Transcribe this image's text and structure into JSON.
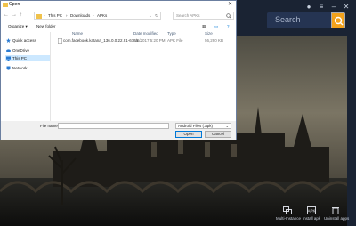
{
  "dialog": {
    "title": "Open",
    "address": {
      "crumbs": [
        "This PC",
        "Downloads",
        "APKs"
      ],
      "separator": "›"
    },
    "search_placeholder": "Search APKs",
    "toolbar": {
      "organize": "Organize ▾",
      "new_folder": "New folder"
    },
    "sidebar": [
      {
        "label": "Quick access",
        "icon": "star-icon"
      },
      {
        "label": "OneDrive",
        "icon": "cloud-icon"
      },
      {
        "label": "This PC",
        "icon": "computer-icon",
        "selected": true
      },
      {
        "label": "Network",
        "icon": "network-icon"
      }
    ],
    "columns": [
      "Name",
      "Date modified",
      "Type",
      "Size"
    ],
    "files": [
      {
        "name": "com.facebook.katana_136.0.0.22.91-6765...",
        "modified": "8/8/2017 5:20 PM",
        "type": "APK File",
        "size": "56,290 KB"
      }
    ],
    "file_name_label": "File name:",
    "file_name_value": "",
    "file_type": "Android Files (.apk)",
    "open_label": "Open",
    "cancel_label": "Cancel"
  },
  "emulator": {
    "search_label": "Search",
    "tools": [
      {
        "label": "Multi-Instance",
        "icon": "multi-instance-icon"
      },
      {
        "label": "Install apk",
        "icon": "install-apk-icon"
      },
      {
        "label": "Uninstall apps",
        "icon": "trash-icon"
      }
    ]
  },
  "colors": {
    "accent": "#f3a21c",
    "emulator_bar": "#1a2333",
    "selection": "#cce8ff"
  }
}
